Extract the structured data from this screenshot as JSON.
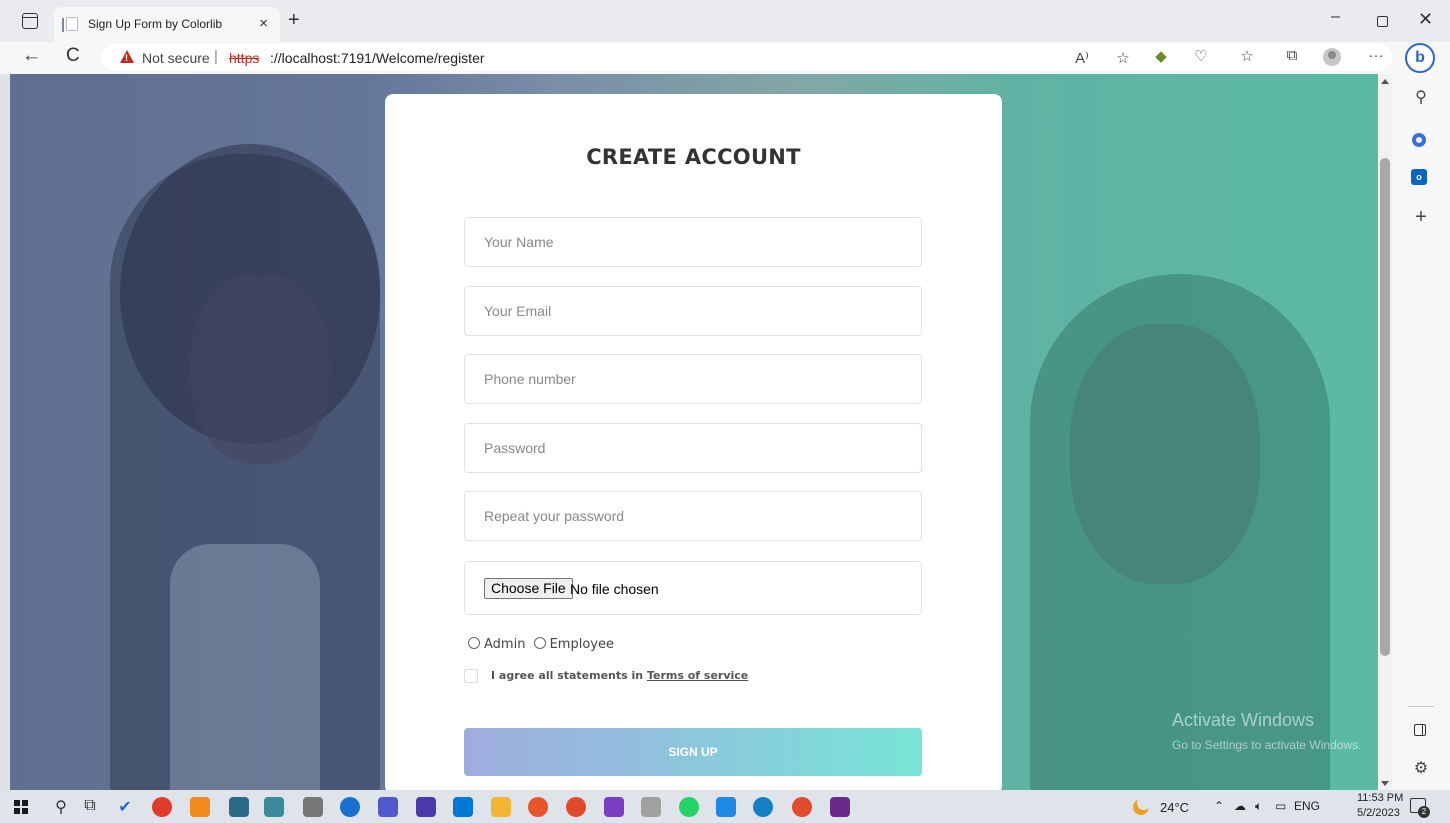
{
  "browser": {
    "tab_title": "Sign Up Form by Colorlib",
    "tab_close": "×",
    "new_tab": "+",
    "min": "–",
    "close": "✕",
    "back": "←",
    "refresh": "C",
    "security_label": "Not secure",
    "url_separator": "|",
    "url_scheme": "https",
    "url_rest": "://localhost:7191/Welcome/register",
    "read_aloud": "A⁾",
    "favorite": "☆",
    "more": "···",
    "bing": "b"
  },
  "sidebar": {
    "search": "⚲",
    "add": "+",
    "settings": "⚙"
  },
  "form": {
    "title": "CREATE ACCOUNT",
    "name_placeholder": "Your Name",
    "email_placeholder": "Your Email",
    "phone_placeholder": "Phone number",
    "password_placeholder": "Password",
    "repeat_placeholder": "Repeat your password",
    "choose_file": "Choose File",
    "file_status": "No file chosen",
    "role_admin": "Admin",
    "role_employee": "Employee",
    "agree_text": "I agree all statements in ",
    "terms_link": "Terms of service",
    "signup": "SIGN UP"
  },
  "watermark": {
    "title": "Activate Windows",
    "subtitle": "Go to Settings to activate Windows."
  },
  "taskbar": {
    "temperature": "24°C",
    "language": "ENG",
    "time": "11:53 PM",
    "date": "5/2/2023",
    "notifications": "2"
  },
  "colors": {
    "button_gradient_start": "#9eacdf",
    "button_gradient_end": "#77e5d6",
    "security_warning": "#c42b1c"
  }
}
